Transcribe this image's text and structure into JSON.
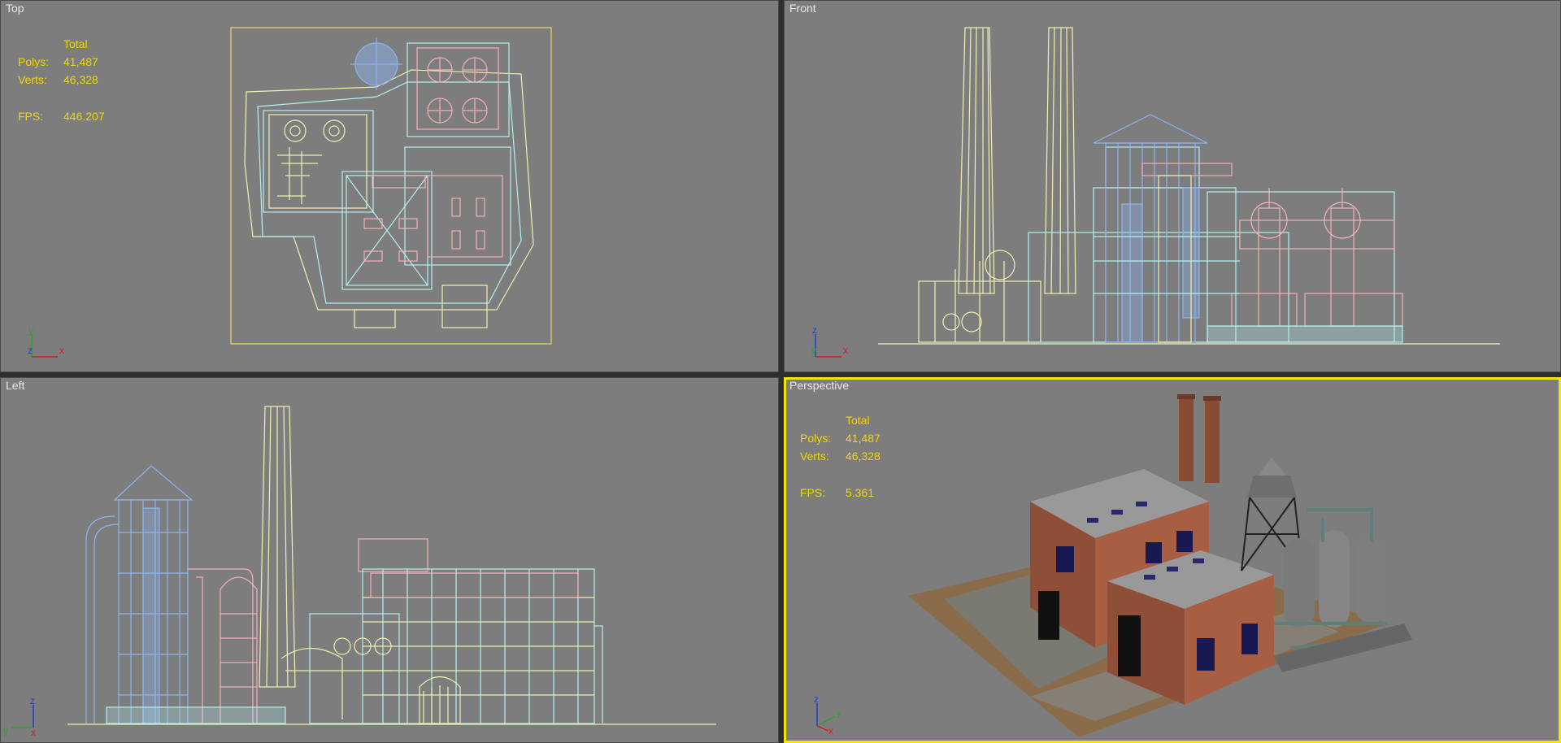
{
  "viewports": {
    "top": {
      "label": "Top",
      "stats": {
        "header": "Total",
        "polys_label": "Polys:",
        "polys": "41,487",
        "verts_label": "Verts:",
        "verts": "46,328",
        "fps_label": "FPS:",
        "fps": "446.207"
      },
      "axes": {
        "a": "y",
        "b": "z",
        "c": "x"
      }
    },
    "front": {
      "label": "Front",
      "axes": {
        "a": "z",
        "b": "y",
        "c": "x"
      }
    },
    "left": {
      "label": "Left",
      "axes": {
        "a": "z",
        "b": "y",
        "c": "x"
      }
    },
    "perspective": {
      "label": "Perspective",
      "stats": {
        "header": "Total",
        "polys_label": "Polys:",
        "polys": "41,487",
        "verts_label": "Verts:",
        "verts": "46,328",
        "fps_label": "FPS:",
        "fps": "5.361"
      },
      "axes": {
        "a": "z",
        "b": "y",
        "c": "x"
      }
    }
  },
  "colors": {
    "viewport_bg": "#7d7d7d",
    "active_border": "#f2e600",
    "stats_text": "#f1d800",
    "wire_yellow": "#f0f0b0",
    "wire_cyan": "#b4f0f0",
    "wire_pink": "#f4b0b8",
    "wire_blue": "#8cb4f0"
  }
}
